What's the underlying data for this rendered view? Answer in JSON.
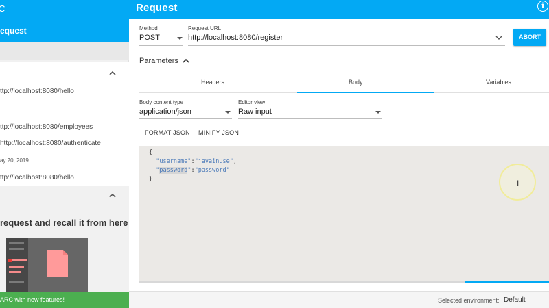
{
  "app": {
    "title_fragment": "C",
    "request_title": "Request"
  },
  "sidebar": {
    "active_label": "equest",
    "history": [
      {
        "url": "ttp://localhost:8080/hello"
      },
      {
        "url": "ttp://localhost:8080/employees"
      },
      {
        "url": "http://localhost:8080/authenticate"
      },
      {
        "date": "ay 20, 2019"
      },
      {
        "url": "ttp://localhost:8080/hello"
      }
    ],
    "saved_text": "request and recall it from here",
    "promo": "ARC with new features!"
  },
  "request": {
    "method_label": "Method",
    "method_value": "POST",
    "url_label": "Request URL",
    "url_value": "http://localhost:8080/register",
    "abort_label": "ABORT"
  },
  "parameters": {
    "label": "Parameters",
    "tabs": [
      "Headers",
      "Body",
      "Variables"
    ],
    "active_tab": "Body"
  },
  "body": {
    "content_type_label": "Body content type",
    "content_type_value": "application/json",
    "editor_view_label": "Editor view",
    "editor_view_value": "Raw input",
    "format_label": "FORMAT JSON",
    "minify_label": "MINIFY JSON",
    "code": {
      "open": "{",
      "line1_key": "\"username\"",
      "line1_value": "\"javainuse\"",
      "line2_key_pre": "\"",
      "line2_key_word": "password",
      "line2_key_post": "\"",
      "line2_value": "\"password\"",
      "close": "}"
    }
  },
  "footer": {
    "env_label": "Selected environment:",
    "env_value": "Default"
  },
  "colors": {
    "accent": "#03a9f4",
    "promo": "#4caf50",
    "editor_bg": "#ebe9e6"
  }
}
